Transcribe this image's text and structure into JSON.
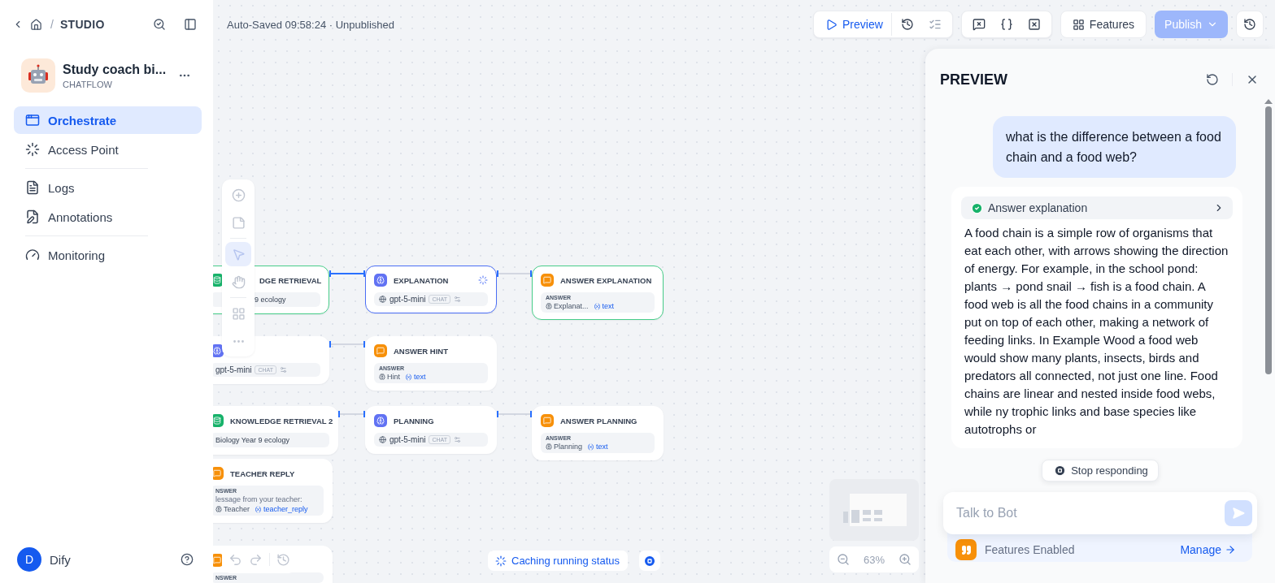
{
  "sidebar": {
    "back_separator": "/",
    "breadcrumb": "STUDIO",
    "app": {
      "name": "Study coach bi...",
      "type": "CHATFLOW"
    },
    "nav": [
      {
        "label": "Orchestrate",
        "selected": true
      },
      {
        "label": "Access Point",
        "selected": false
      },
      {
        "label": "Logs",
        "selected": false
      },
      {
        "label": "Annotations",
        "selected": false
      },
      {
        "label": "Monitoring",
        "selected": false
      }
    ],
    "user": {
      "initial": "D",
      "name": "Dify"
    }
  },
  "toolbar": {
    "status": "Auto-Saved 09:58:24 · Unpublished",
    "preview": "Preview",
    "features": "Features",
    "publish": {
      "label": "Publish",
      "disabled": true
    }
  },
  "canvas": {
    "tools": [
      {
        "kind": "add",
        "selected": false
      },
      {
        "kind": "note",
        "selected": false
      },
      {
        "kind": "pointer",
        "selected": true
      },
      {
        "kind": "hand",
        "selected": false
      },
      {
        "kind": "blocks",
        "selected": false
      },
      {
        "kind": "more",
        "selected": false
      }
    ],
    "nodes": [
      {
        "kind": "knowledge",
        "title": "DGE RETRIEVAL",
        "succeeded": true,
        "running": false,
        "dataset": "9 ecology"
      },
      {
        "kind": "llm",
        "title": "EXPLANATION",
        "succeeded": false,
        "running": true,
        "model": "gpt-5-mini",
        "mode": "CHAT"
      },
      {
        "kind": "answer",
        "title": "ANSWER EXPLANATION",
        "succeeded": true,
        "running": false,
        "label": "ANSWER",
        "lines": [
          {
            "kind": "var",
            "source": "Explanat...",
            "variable": "text"
          }
        ]
      },
      {
        "kind": "llm",
        "model": "gpt-5-mini",
        "mode": "CHAT"
      },
      {
        "kind": "answer",
        "title": "ANSWER HINT",
        "label": "ANSWER",
        "lines": [
          {
            "kind": "var",
            "source": "Hint",
            "variable": "text"
          }
        ]
      },
      {
        "kind": "knowledge",
        "title": "KNOWLEDGE RETRIEVAL 2",
        "dataset": "Biology Year 9 ecology"
      },
      {
        "kind": "llm",
        "title": "PLANNING",
        "model": "gpt-5-mini",
        "mode": "CHAT"
      },
      {
        "kind": "answer",
        "title": "ANSWER PLANNING",
        "label": "ANSWER",
        "lines": [
          {
            "kind": "var",
            "source": "Planning",
            "variable": "text"
          }
        ]
      },
      {
        "kind": "answer",
        "title": "TEACHER REPLY",
        "label": "NSWER",
        "lines": [
          {
            "kind": "text",
            "text": "lessage from your teacher:"
          },
          {
            "kind": "var",
            "source": "Teacher",
            "variable": "teacher_reply"
          }
        ]
      },
      {
        "kind": "answer",
        "label": "NSWER"
      }
    ],
    "edges": [
      {
        "active": true
      },
      {
        "active": false
      },
      {
        "active": false
      },
      {
        "active": false
      },
      {
        "active": false
      }
    ],
    "run_status": "Caching running status",
    "zoom": "63%"
  },
  "preview": {
    "title": "PREVIEW",
    "messages": [
      {
        "kind": "user",
        "text": "what is the difference between a food chain and a food web?"
      },
      {
        "kind": "bot",
        "process": {
          "label": "Answer explanation",
          "succeeded": true
        },
        "text": "A food chain is a simple row of organisms that eat each other, with arrows showing the direction of energy. For example, in the school pond: plants → pond snail → fish is a food chain. A food web is all the food chains in a community put on top of each other, making a network of feeding links. In Example Wood a food web would show many plants, insects, birds and predators all connected, not just one line. Food chains are linear and nested inside food webs, while ny trophic links and base species like autotrophs or"
      }
    ],
    "stop_button": "Stop responding",
    "input": {
      "placeholder": "Talk to Bot"
    },
    "features": {
      "label": "Features Enabled",
      "action": "Manage"
    }
  }
}
